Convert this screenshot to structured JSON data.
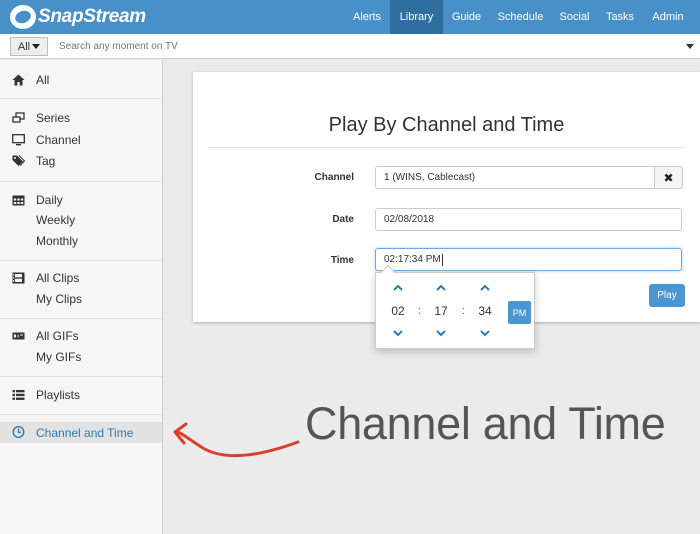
{
  "brand": {
    "name": "SnapStream"
  },
  "nav": {
    "items": [
      {
        "label": "Alerts"
      },
      {
        "label": "Library"
      },
      {
        "label": "Guide"
      },
      {
        "label": "Schedule"
      },
      {
        "label": "Social"
      },
      {
        "label": "Tasks"
      },
      {
        "label": "Admin"
      }
    ],
    "active": "Library"
  },
  "search": {
    "scope": "All",
    "placeholder": "Search any moment on TV"
  },
  "sidebar": {
    "items": [
      {
        "label": "All",
        "icon": "home-icon"
      },
      {
        "label": "Series",
        "icon": "series-icon"
      },
      {
        "label": "Channel",
        "icon": "monitor-icon"
      },
      {
        "label": "Tag",
        "icon": "tags-icon"
      },
      {
        "label": "Daily",
        "icon": "calendar-icon"
      },
      {
        "label": "Weekly",
        "icon": ""
      },
      {
        "label": "Monthly",
        "icon": ""
      },
      {
        "label": "All Clips",
        "icon": "film-icon"
      },
      {
        "label": "My Clips",
        "icon": ""
      },
      {
        "label": "All GIFs",
        "icon": "gif-icon"
      },
      {
        "label": "My GIFs",
        "icon": ""
      },
      {
        "label": "Playlists",
        "icon": "list-icon"
      },
      {
        "label": "Channel and Time",
        "icon": "clock-icon"
      }
    ],
    "active": "Channel and Time"
  },
  "form": {
    "title": "Play By Channel and Time",
    "channel_label": "Channel",
    "channel_value": "1 (WINS, Cablecast)",
    "clear_symbol": "✖",
    "date_label": "Date",
    "date_value": "02/08/2018",
    "time_label": "Time",
    "time_value": "02:17:34 PM",
    "play_label": "Play"
  },
  "time_picker": {
    "hour": "02",
    "minute": "17",
    "second": "34",
    "meridian": "PM",
    "separator": ":"
  },
  "annotation": {
    "text": "Channel and Time",
    "arrow_color": "#d9412f"
  },
  "colors": {
    "accent": "#4a90c8",
    "active_nav": "#2e6f9f",
    "button": "#4a96d2",
    "active_link": "#2e7ab8"
  }
}
